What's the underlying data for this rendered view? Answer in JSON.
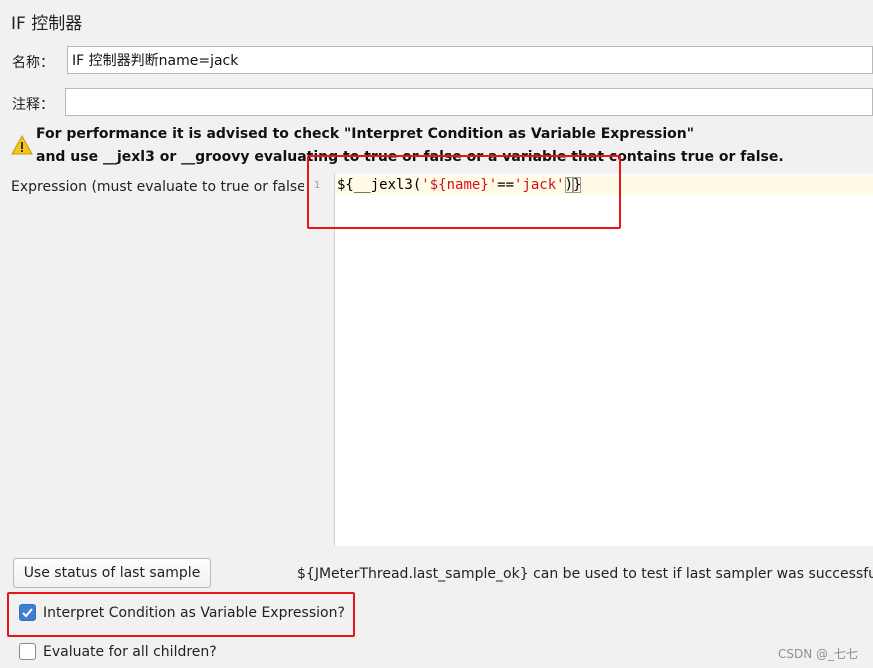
{
  "panel": {
    "title": "IF 控制器"
  },
  "name_field": {
    "label": "名称：",
    "value": "IF 控制器判断name=jack"
  },
  "comment_field": {
    "label": "注释：",
    "value": ""
  },
  "warning": {
    "icon": "warning-triangle-icon",
    "line1": "For performance it is advised to check \"Interpret Condition as Variable Expression\"",
    "line2": "and use __jexl3 or __groovy evaluating to true or false or a variable that contains true or false."
  },
  "expression": {
    "label": "Expression (must evaluate to true or false)",
    "line_number": "1",
    "code": {
      "open": "${",
      "func": "__jexl3(",
      "arg1": "'${name}'",
      "op": "==",
      "arg2": "'jack'",
      "close_paren": ")",
      "close_brace": "}"
    }
  },
  "use_status_button": {
    "label": "Use status of last sample"
  },
  "hint": {
    "text": "${JMeterThread.last_sample_ok} can be used to test if last sampler was successful"
  },
  "checkboxes": {
    "interpret": {
      "label": "Interpret Condition as Variable Expression?",
      "checked": true
    },
    "evaluate_all": {
      "label": "Evaluate for all children?",
      "checked": false
    }
  },
  "watermark": {
    "text": "CSDN @_七七"
  },
  "colors": {
    "annotation_red": "#e5151c",
    "checkbox_blue": "#3f7fd1",
    "string_red": "#d4121e"
  }
}
